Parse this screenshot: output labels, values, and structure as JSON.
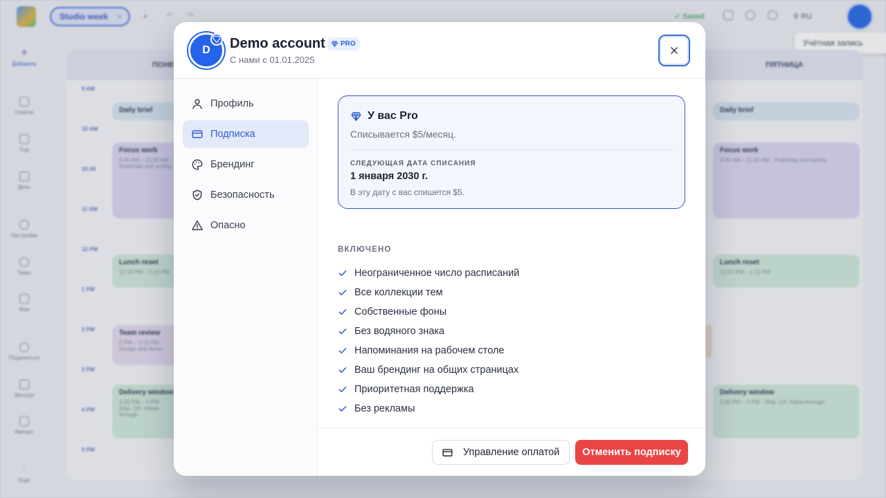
{
  "background": {
    "schedule_pill": "Studio week",
    "saved_label": "Saved",
    "lang_label": "RU",
    "account_tooltip": "Учётная запись",
    "sidebar": [
      {
        "label": "Добавить",
        "icon": "plus-icon",
        "accent": true
      },
      {
        "label": "Список",
        "icon": "list-icon"
      },
      {
        "label": "Год",
        "icon": "calendar-icon"
      },
      {
        "label": "День",
        "icon": "day-icon"
      },
      {
        "label": "Настройки",
        "icon": "gear-icon"
      },
      {
        "label": "Темы",
        "icon": "palette-icon"
      },
      {
        "label": "Фон",
        "icon": "image-icon"
      },
      {
        "label": "Поделиться",
        "icon": "share-icon"
      },
      {
        "label": "Экспорт",
        "icon": "export-icon"
      },
      {
        "label": "Импорт",
        "icon": "import-icon"
      },
      {
        "label": "Ещё",
        "icon": "more-icon"
      }
    ],
    "days": [
      "ПОНЕ",
      "ПЯТНИЦА"
    ],
    "times": [
      "9 AM",
      "10 AM",
      "10:30",
      "11 AM",
      "12 PM",
      "1 PM",
      "2 PM",
      "3 PM",
      "4 PM",
      "5 PM"
    ],
    "events": [
      {
        "title": "Daily brief",
        "sub": "",
        "color": "blue"
      },
      {
        "title": "Focus work",
        "sub": "9:30 AM – 11:30 AM · Roadmap and writing",
        "color": "purple"
      },
      {
        "title": "Lunch reset",
        "sub": "12:15 PM – 1:15 PM",
        "color": "green"
      },
      {
        "title": "Team review",
        "sub": "2 PM – 2:15 PM · Design and demo",
        "color": "lilac"
      },
      {
        "title": "Delivery window",
        "sub": "3:30 PM – 5 PM · Ship, QA, follow-through",
        "color": "green"
      }
    ]
  },
  "modal": {
    "avatar_initial": "D",
    "account_name": "Demo account",
    "pro_badge": "PRO",
    "member_since": "С нами с 01.01.2025",
    "nav": [
      {
        "label": "Профиль",
        "icon": "user-icon"
      },
      {
        "label": "Подписка",
        "icon": "credit-card-icon",
        "active": true
      },
      {
        "label": "Брендинг",
        "icon": "palette-icon"
      },
      {
        "label": "Безопасность",
        "icon": "shield-icon"
      },
      {
        "label": "Опасно",
        "icon": "warning-icon"
      }
    ],
    "plan": {
      "title": "У вас Pro",
      "billing": "Списывается $5/месяц.",
      "next_label": "СЛЕДУЮЩАЯ ДАТА СПИСАНИЯ",
      "next_date": "1 января 2030 г.",
      "next_note": "В эту дату с вас спишется $5."
    },
    "included_label": "ВКЛЮЧЕНО",
    "features": [
      "Неограниченное число расписаний",
      "Все коллекции тем",
      "Собственные фоны",
      "Без водяного знака",
      "Напоминания на рабочем столе",
      "Ваш брендинг на общих страницах",
      "Приоритетная поддержка",
      "Без рекламы"
    ],
    "manage_billing_label": "Управление оплатой",
    "cancel_label": "Отменить подписку"
  },
  "colors": {
    "accent": "#2563eb",
    "danger": "#ea4545",
    "check": "#2f5fd0"
  }
}
